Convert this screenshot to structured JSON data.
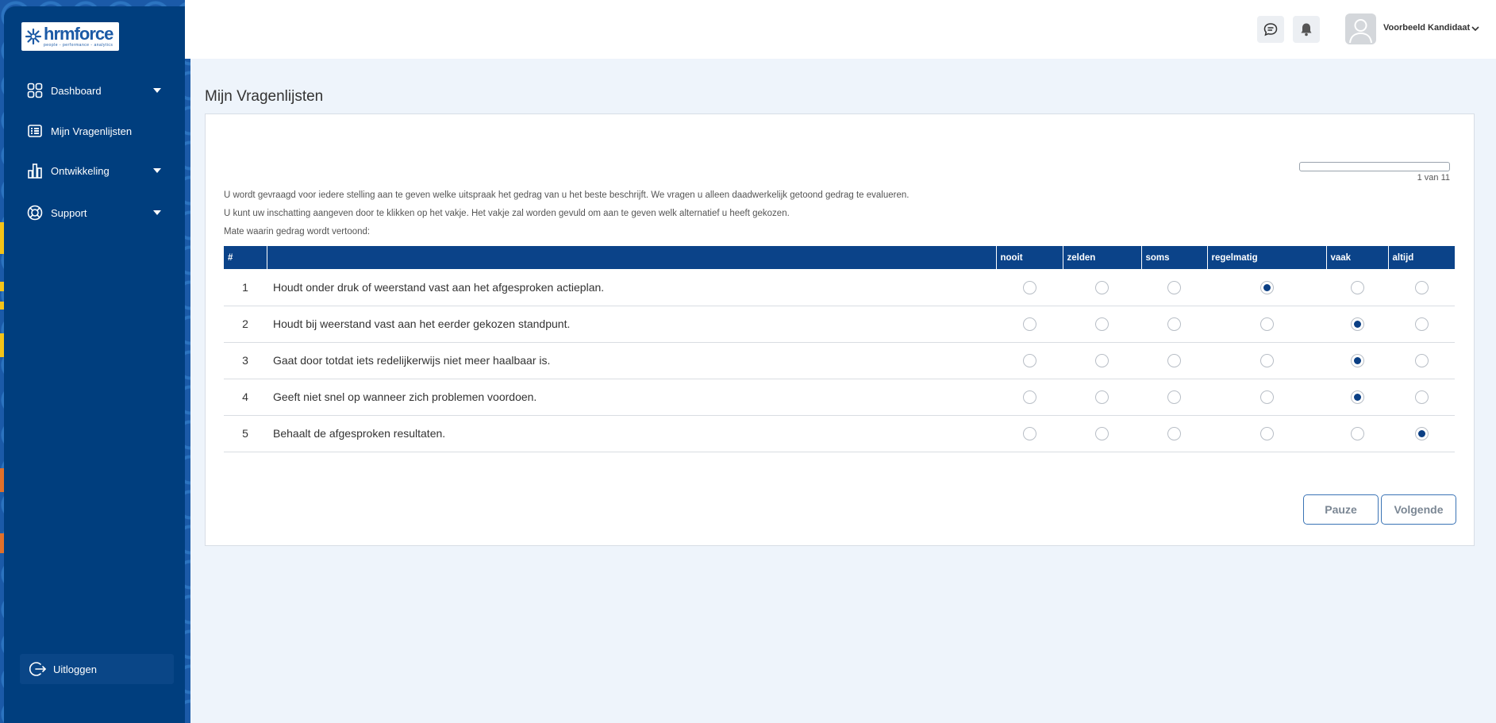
{
  "brand": {
    "logo_word": "hrmforce",
    "logo_tagline": "people - performance - analytics",
    "accent": "#003e7e",
    "header_blue": "#0b4389"
  },
  "sidebar": {
    "items": [
      {
        "label": "Dashboard",
        "icon": "grid-icon",
        "has_caret": true
      },
      {
        "label": "Mijn Vragenlijsten",
        "icon": "list-icon",
        "has_caret": false
      },
      {
        "label": "Ontwikkeling",
        "icon": "bar-chart-icon",
        "has_caret": true
      },
      {
        "label": "Support",
        "icon": "lifebuoy-icon",
        "has_caret": true
      }
    ],
    "logout_label": "Uitloggen"
  },
  "topbar": {
    "user_name": "Voorbeeld Kandidaat",
    "icons": [
      "chat-icon",
      "bell-icon",
      "avatar",
      "chevron-down-icon"
    ]
  },
  "page": {
    "title": "Mijn Vragenlijsten"
  },
  "questionnaire": {
    "progress_fraction": 0.0,
    "progress_label": "1 van 11",
    "instructions": [
      "U wordt gevraagd voor iedere stelling aan te geven welke uitspraak het gedrag van u het beste beschrijft. We vragen u alleen daadwerkelijk getoond gedrag te evalueren.",
      "U kunt uw inschatting aangeven door te klikken op het vakje. Het vakje zal worden gevuld om aan te geven welk alternatief u heeft gekozen.",
      "Mate waarin gedrag wordt vertoond:"
    ],
    "columns": {
      "number": "#",
      "statement": "",
      "options": [
        "nooit",
        "zelden",
        "soms",
        "regelmatig",
        "vaak",
        "altijd"
      ]
    },
    "rows": [
      {
        "num": "1",
        "text": "Houdt onder druk of weerstand vast aan het afgesproken actieplan.",
        "selected": "regelmatig"
      },
      {
        "num": "2",
        "text": "Houdt bij weerstand vast aan het eerder gekozen standpunt.",
        "selected": "vaak"
      },
      {
        "num": "3",
        "text": "Gaat door totdat iets redelijkerwijs niet meer haalbaar is.",
        "selected": "vaak"
      },
      {
        "num": "4",
        "text": "Geeft niet snel op wanneer zich problemen voordoen.",
        "selected": "vaak"
      },
      {
        "num": "5",
        "text": "Behaalt de afgesproken resultaten.",
        "selected": "altijd"
      }
    ],
    "pause_label": "Pauze",
    "next_label": "Volgende"
  }
}
